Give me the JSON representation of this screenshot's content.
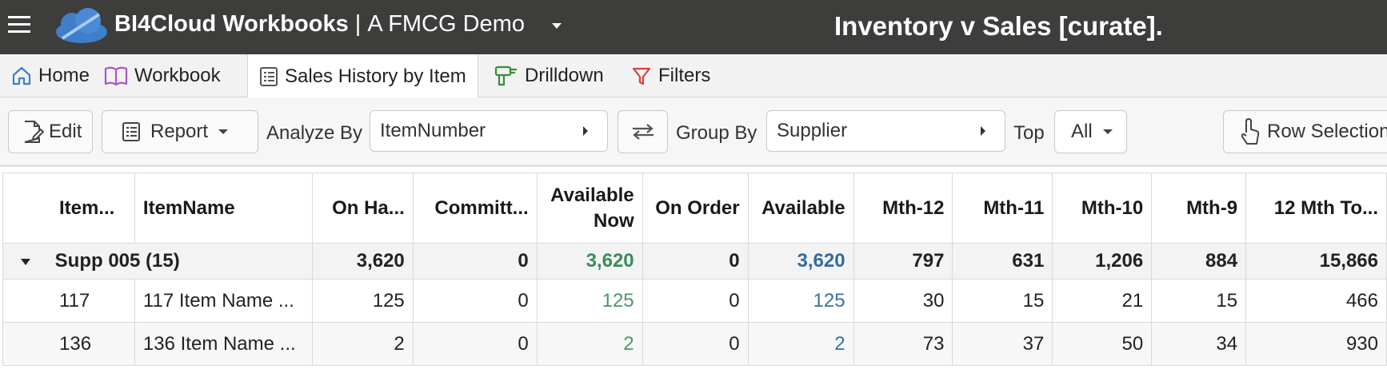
{
  "header": {
    "app_name": "BI4Cloud Workbooks",
    "separator": "|",
    "tenant": "A FMCG Demo",
    "workbook_title": "Inventory v Sales [curate]."
  },
  "tabs": [
    {
      "label": "Home",
      "icon": "home-icon"
    },
    {
      "label": "Workbook",
      "icon": "book-icon"
    },
    {
      "label": "Sales History by Item",
      "icon": "list-icon",
      "active": true
    },
    {
      "label": "Drilldown",
      "icon": "drill-icon"
    },
    {
      "label": "Filters",
      "icon": "filter-icon"
    }
  ],
  "toolbar": {
    "edit_label": "Edit",
    "report_label": "Report",
    "analyze_by_label": "Analyze By",
    "analyze_by_value": "ItemNumber",
    "group_by_label": "Group By",
    "group_by_value": "Supplier",
    "top_label": "Top",
    "top_value": "All",
    "row_selection_label": "Row Selection"
  },
  "table": {
    "headers": [
      "Item...",
      "ItemName",
      "On Ha...",
      "Committ...",
      "Available Now",
      "On Order",
      "Available",
      "Mth-12",
      "Mth-11",
      "Mth-10",
      "Mth-9",
      "12 Mth To..."
    ],
    "available_now_line1": "Available",
    "available_now_line2": "Now",
    "group": {
      "label": "Supp 005 (15)",
      "values": [
        "3,620",
        "0",
        "3,620",
        "0",
        "3,620",
        "797",
        "631",
        "1,206",
        "884",
        "15,866"
      ]
    },
    "rows": [
      {
        "item": "117",
        "name": "117 Item Name ...",
        "values": [
          "125",
          "0",
          "125",
          "0",
          "125",
          "30",
          "15",
          "21",
          "15",
          "466"
        ]
      },
      {
        "item": "136",
        "name": "136 Item Name ...",
        "values": [
          "2",
          "0",
          "2",
          "0",
          "2",
          "73",
          "37",
          "50",
          "34",
          "930"
        ]
      }
    ]
  },
  "colors": {
    "header_bg": "#3d3d3b",
    "available_now": "#3e8a5b",
    "available": "#356aa0",
    "logo": "#3f7fc9"
  }
}
